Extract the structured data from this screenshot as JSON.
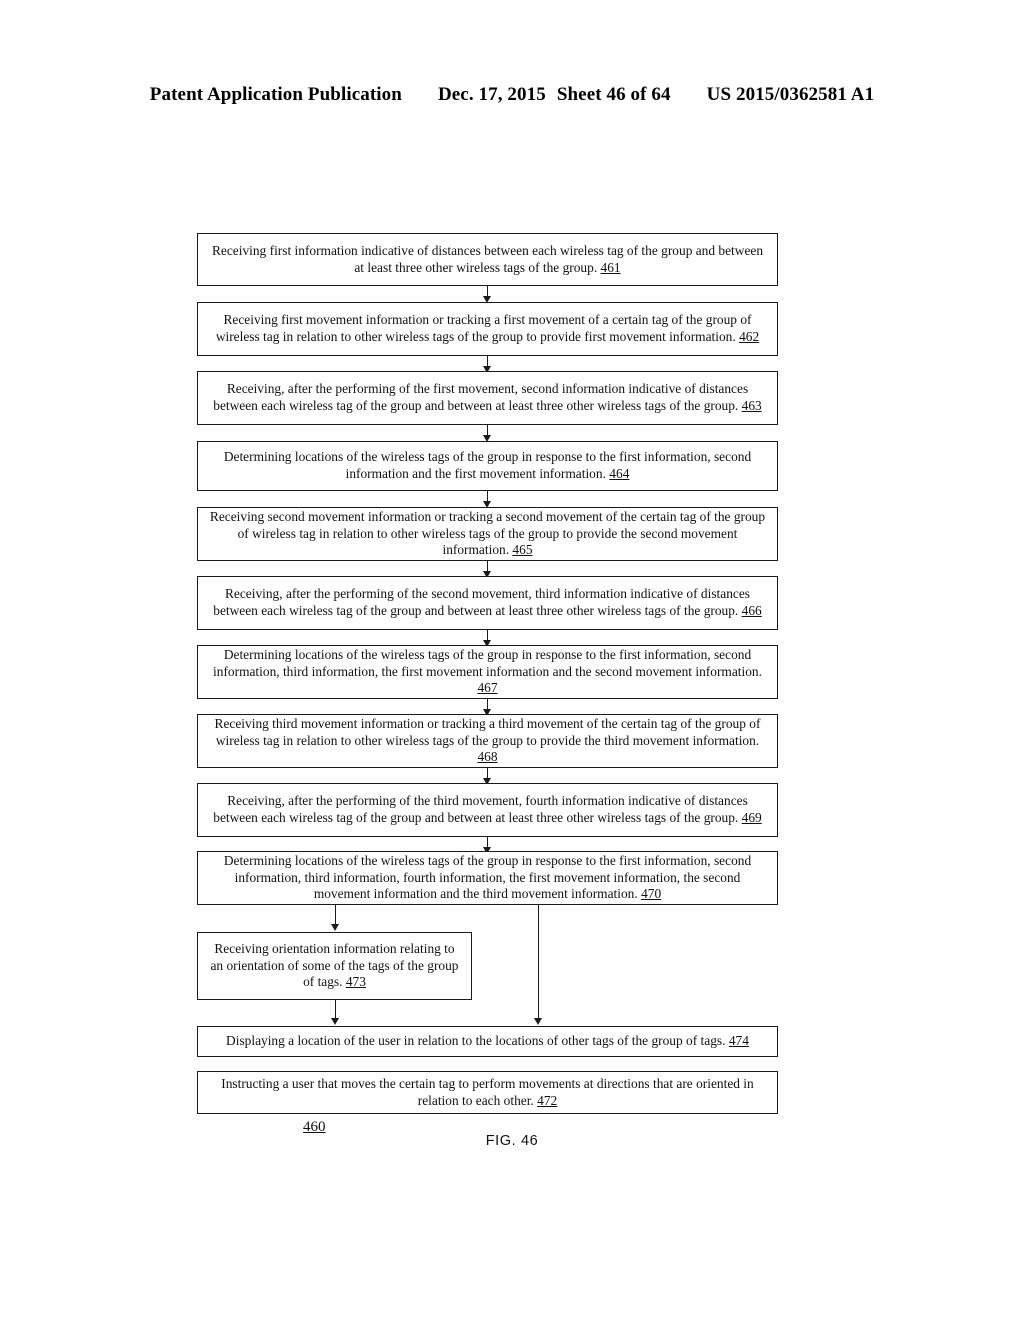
{
  "header": {
    "publication": "Patent Application Publication",
    "date": "Dec. 17, 2015",
    "sheet": "Sheet 46 of 64",
    "patent_number": "US 2015/0362581 A1"
  },
  "figure": {
    "caption": "FIG. 46",
    "diagram_ref": "460"
  },
  "flowchart": {
    "boxes": [
      {
        "id": "461",
        "text": "Receiving first information indicative of distances between each wireless tag of the group and between at least three other wireless tags of the group.",
        "ref": "461"
      },
      {
        "id": "462",
        "text": "Receiving first movement information or tracking a first movement of a certain tag of the group of wireless tag in relation to other wireless tags of the group to provide first movement information.",
        "ref": "462"
      },
      {
        "id": "463",
        "text": "Receiving, after the performing of the first movement, second information indicative of distances between each wireless tag of the group and between at least three other wireless tags of the group.",
        "ref": "463"
      },
      {
        "id": "464",
        "text": "Determining locations of the wireless tags of the group in response to the first information, second information and the first movement information.",
        "ref": "464"
      },
      {
        "id": "465",
        "text": "Receiving second movement information or tracking a second movement of the certain tag of the group of wireless tag in relation to other wireless tags of the group to provide the second movement information.",
        "ref": "465"
      },
      {
        "id": "466",
        "text": "Receiving, after the performing of the second movement, third information indicative of distances between each wireless tag of the group and between at least three other wireless tags of the group.",
        "ref": "466"
      },
      {
        "id": "467",
        "text": "Determining locations of the wireless tags of the group in response to the first information, second information, third information, the first movement information and the second movement information.",
        "ref": "467"
      },
      {
        "id": "468",
        "text": "Receiving third movement information or tracking a third movement of the certain tag of the group of wireless tag in relation to other wireless tags of the group to provide the third movement information.",
        "ref": "468"
      },
      {
        "id": "469",
        "text": "Receiving, after the performing of the third movement, fourth information indicative of distances between each wireless tag of the group and between at least three other wireless tags of the group.",
        "ref": "469"
      },
      {
        "id": "470",
        "text": "Determining locations of the wireless tags of the group in response to the first information, second information, third information, fourth information, the first movement information, the second movement information and the third movement information.",
        "ref": "470"
      },
      {
        "id": "473",
        "text": "Receiving orientation information relating to an orientation of some of the tags of the group of tags.",
        "ref": "473"
      },
      {
        "id": "474",
        "text": "Displaying a location of the user in relation to the locations of other tags of the group of tags.",
        "ref": "474"
      },
      {
        "id": "472",
        "text": "Instructing a user that moves the certain tag to perform movements at directions that are oriented in relation to each other.",
        "ref": "472"
      }
    ]
  }
}
